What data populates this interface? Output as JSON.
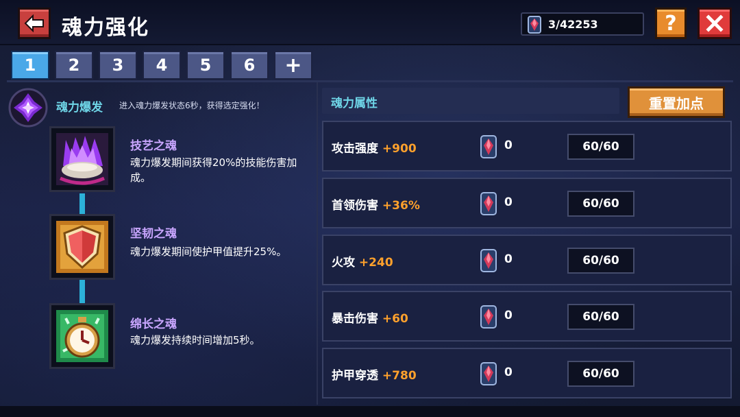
{
  "header": {
    "title": "魂力强化",
    "currency_value": "3/42253",
    "help_label": "?",
    "back_icon": "arrow-left-icon",
    "close_icon": "close-icon",
    "currency_icon": "soul-gem-icon"
  },
  "tabs": [
    {
      "label": "1",
      "active": true
    },
    {
      "label": "2",
      "active": false
    },
    {
      "label": "3",
      "active": false
    },
    {
      "label": "4",
      "active": false
    },
    {
      "label": "5",
      "active": false
    },
    {
      "label": "6",
      "active": false
    },
    {
      "label": "+",
      "active": false
    }
  ],
  "burst": {
    "title": "魂力爆发",
    "description": "进入魂力爆发状态6秒，获得选定强化！"
  },
  "skills": [
    {
      "name": "技艺之魂",
      "description": "魂力爆发期间获得20%的技能伤害加成。",
      "icon": "purple-flame-icon"
    },
    {
      "name": "坚韧之魂",
      "description": "魂力爆发期间使护甲值提升25%。",
      "icon": "shield-icon"
    },
    {
      "name": "绵长之魂",
      "description": "魂力爆发持续时间增加5秒。",
      "icon": "stopwatch-icon"
    }
  ],
  "attributes_panel": {
    "title": "魂力属性",
    "reset_label": "重置加点"
  },
  "attributes": [
    {
      "name": "攻击强度",
      "bonus": "+900",
      "count": "0",
      "level": "60/60"
    },
    {
      "name": "首领伤害",
      "bonus": "+36%",
      "count": "0",
      "level": "60/60"
    },
    {
      "name": "火攻",
      "bonus": "+240",
      "count": "0",
      "level": "60/60"
    },
    {
      "name": "暴击伤害",
      "bonus": "+60",
      "count": "0",
      "level": "60/60"
    },
    {
      "name": "护甲穿透",
      "bonus": "+780",
      "count": "0",
      "level": "60/60"
    }
  ],
  "colors": {
    "accent_cyan": "#6fd6e8",
    "bonus_orange": "#ffa12c",
    "skill_name_purple": "#c9a6ff",
    "active_tab": "#4aa8e8"
  }
}
